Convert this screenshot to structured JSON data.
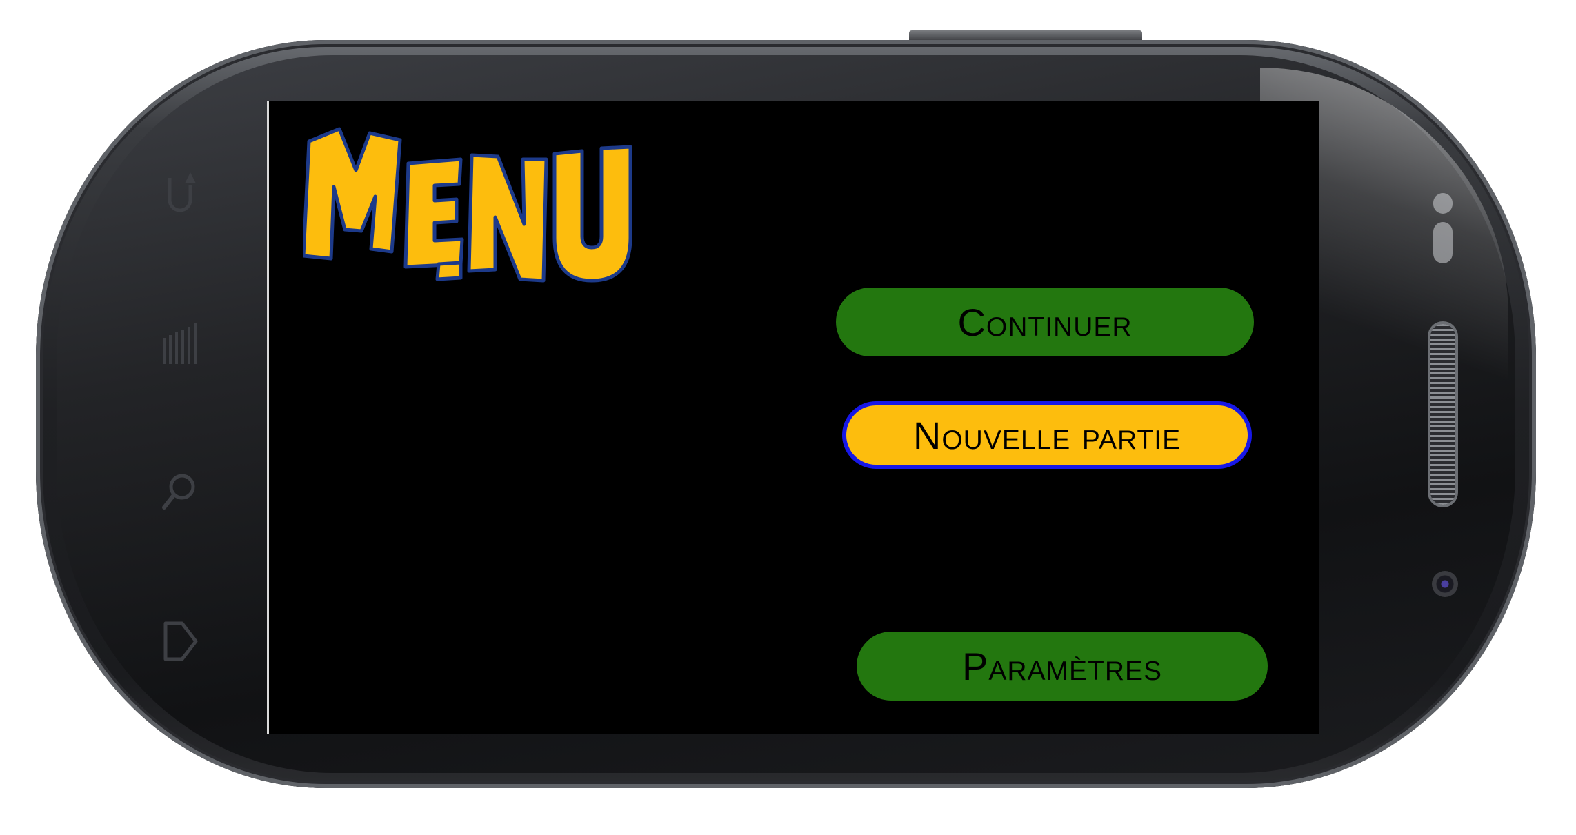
{
  "logo": {
    "text": "MENU",
    "fill_color": "#fdbd0d",
    "outline_color": "#1d3a8a"
  },
  "menu": {
    "continue_label": "Continuer",
    "new_game_label": "Nouvelle partie",
    "settings_label": "Paramètres",
    "selected_item": "Nouvelle partie"
  },
  "colors": {
    "button_green": "#23770f",
    "button_selected": "#fdbd0d",
    "selected_border": "#1717e8",
    "screen_bg": "#000000"
  },
  "device": {
    "soft_keys": [
      "back-icon",
      "menu-icon",
      "search-icon",
      "home-icon"
    ]
  }
}
